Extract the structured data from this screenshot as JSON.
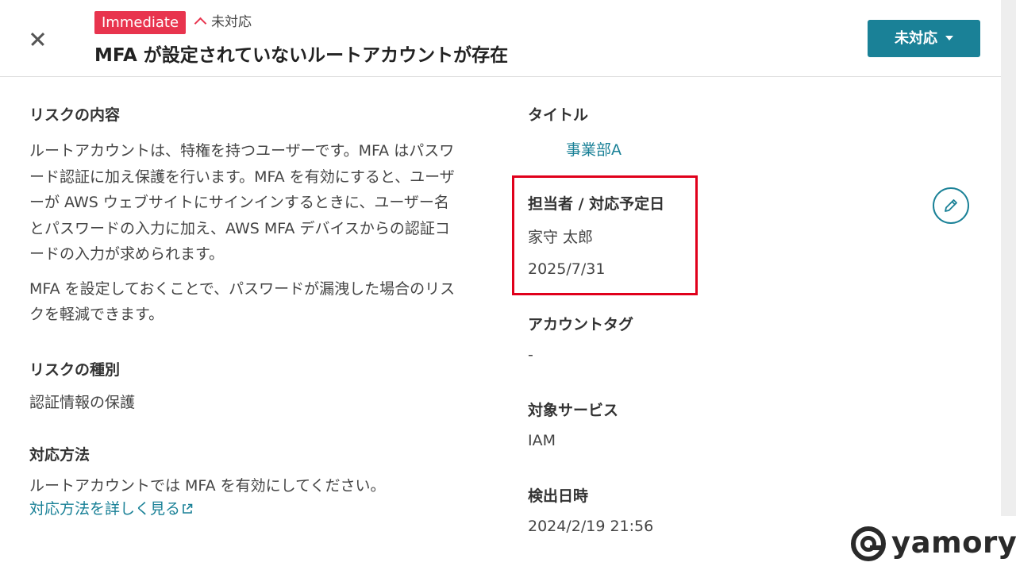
{
  "header": {
    "severity_badge": "Immediate",
    "status_inline": "未対応",
    "title": "MFA が設定されていないルートアカウントが存在",
    "status_button_label": "未対応"
  },
  "left": {
    "risk_heading": "リスクの内容",
    "risk_para1_lines": [
      "ルートアカウントは、特権を持つユーザーです。MFA はパスワ",
      "ード認証に加え保護を行います。MFA を有効にすると、ユーザ",
      "ーが AWS ウェブサイトにサインインするときに、ユーザー名",
      "とパスワードの入力に加え、AWS MFA デバイスからの認証コ",
      "ードの入力が求められます。"
    ],
    "risk_para2_lines": [
      "MFA を設定しておくことで、パスワードが漏洩した場合のリス",
      "クを軽減できます。"
    ],
    "type_heading": "リスクの種別",
    "type_value": "認証情報の保護",
    "method_heading": "対応方法",
    "method_text": "ルートアカウントでは MFA を有効にしてください。",
    "method_link": "対応方法を詳しく見る"
  },
  "right": {
    "title_heading": "タイトル",
    "title_value": "事業部A",
    "assignee_heading": "担当者 / 対応予定日",
    "assignee_name": "家守 太郎",
    "due_date": "2025/7/31",
    "account_tag_heading": "アカウントタグ",
    "account_tag_value": "-",
    "service_heading": "対象サービス",
    "service_value": "IAM",
    "detected_heading": "検出日時",
    "detected_value": "2024/2/19 21:56"
  },
  "icons": {
    "close": "close-icon",
    "edit": "pencil-icon",
    "external": "external-link-icon",
    "chevron": "chevron-up-icon",
    "caret": "caret-down-icon"
  },
  "colors": {
    "badge": "#e8344e",
    "accent": "#1a8197",
    "highlight": "#e0001b"
  },
  "branding": {
    "logo_text": "yamory"
  }
}
